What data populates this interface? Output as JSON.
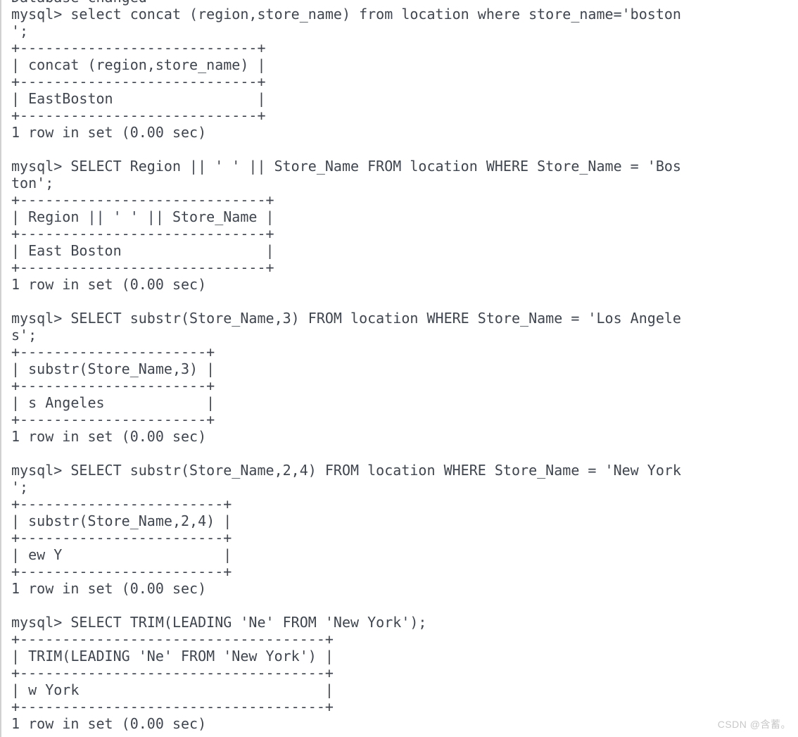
{
  "terminal": {
    "app": "mysql-client-console",
    "prompt": "mysql>",
    "text_color": "#40464f",
    "background_color": "#ffffff",
    "lines": [
      "Database changed",
      "mysql> select concat (region,store_name) from location where store_name='boston",
      "';",
      "+----------------------------+",
      "| concat (region,store_name) |",
      "+----------------------------+",
      "| EastBoston                 |",
      "+----------------------------+",
      "1 row in set (0.00 sec)",
      "",
      "mysql> SELECT Region || ' ' || Store_Name FROM location WHERE Store_Name = 'Bos",
      "ton';",
      "+-----------------------------+",
      "| Region || ' ' || Store_Name |",
      "+-----------------------------+",
      "| East Boston                 |",
      "+-----------------------------+",
      "1 row in set (0.00 sec)",
      "",
      "mysql> SELECT substr(Store_Name,3) FROM location WHERE Store_Name = 'Los Angele",
      "s';",
      "+----------------------+",
      "| substr(Store_Name,3) |",
      "+----------------------+",
      "| s Angeles            |",
      "+----------------------+",
      "1 row in set (0.00 sec)",
      "",
      "mysql> SELECT substr(Store_Name,2,4) FROM location WHERE Store_Name = 'New York",
      "';",
      "+------------------------+",
      "| substr(Store_Name,2,4) |",
      "+------------------------+",
      "| ew Y                   |",
      "+------------------------+",
      "1 row in set (0.00 sec)",
      "",
      "mysql> SELECT TRIM(LEADING 'Ne' FROM 'New York');",
      "+------------------------------------+",
      "| TRIM(LEADING 'Ne' FROM 'New York') |",
      "+------------------------------------+",
      "| w York                             |",
      "+------------------------------------+",
      "1 row in set (0.00 sec)"
    ],
    "queries": [
      {
        "sql": "select concat (region,store_name) from location where store_name='boston';",
        "column_header": "concat (region,store_name)",
        "rows": [
          "EastBoston"
        ],
        "status": "1 row in set (0.00 sec)"
      },
      {
        "sql": "SELECT Region || ' ' || Store_Name FROM location WHERE Store_Name = 'Boston';",
        "column_header": "Region || ' ' || Store_Name",
        "rows": [
          "East Boston"
        ],
        "status": "1 row in set (0.00 sec)"
      },
      {
        "sql": "SELECT substr(Store_Name,3) FROM location WHERE Store_Name = 'Los Angeles';",
        "column_header": "substr(Store_Name,3)",
        "rows": [
          "s Angeles"
        ],
        "status": "1 row in set (0.00 sec)"
      },
      {
        "sql": "SELECT substr(Store_Name,2,4) FROM location WHERE Store_Name = 'New York';",
        "column_header": "substr(Store_Name,2,4)",
        "rows": [
          "ew Y"
        ],
        "status": "1 row in set (0.00 sec)"
      },
      {
        "sql": "SELECT TRIM(LEADING 'Ne' FROM 'New York');",
        "column_header": "TRIM(LEADING 'Ne' FROM 'New York')",
        "rows": [
          "w York"
        ],
        "status": "1 row in set (0.00 sec)"
      }
    ]
  },
  "watermark": {
    "text": "CSDN @含蓄。",
    "color": "#c8c8c8"
  }
}
